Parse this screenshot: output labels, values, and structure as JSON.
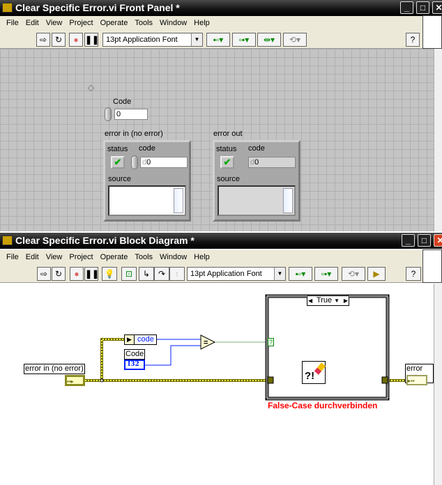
{
  "front_panel": {
    "title": "Clear Specific Error.vi Front Panel *",
    "menu": [
      "File",
      "Edit",
      "View",
      "Project",
      "Operate",
      "Tools",
      "Window",
      "Help"
    ],
    "font": "13pt Application Font",
    "code_control": {
      "label": "Code",
      "value": "0"
    },
    "error_in": {
      "label": "error in (no error)",
      "status_label": "status",
      "code_label": "code",
      "code_prefix": "d",
      "code_value": "0",
      "source_label": "source",
      "source_value": ""
    },
    "error_out": {
      "label": "error out",
      "status_label": "status",
      "code_label": "code",
      "code_prefix": "d",
      "code_value": "0",
      "source_label": "source",
      "source_value": ""
    }
  },
  "block_diagram": {
    "title": "Clear Specific Error.vi Block Diagram *",
    "menu": [
      "File",
      "Edit",
      "View",
      "Project",
      "Operate",
      "Tools",
      "Window",
      "Help"
    ],
    "font": "13pt Application Font",
    "error_in_label": "error in (no error)",
    "error_out_label": "error out",
    "unbundle_field": "code",
    "code_label": "Code",
    "code_type": "I32",
    "equals": "=",
    "case_selector": "True",
    "case_terminal": "?",
    "annotation": "False-Case durchverbinden",
    "annotation_color": "#ff0000"
  }
}
